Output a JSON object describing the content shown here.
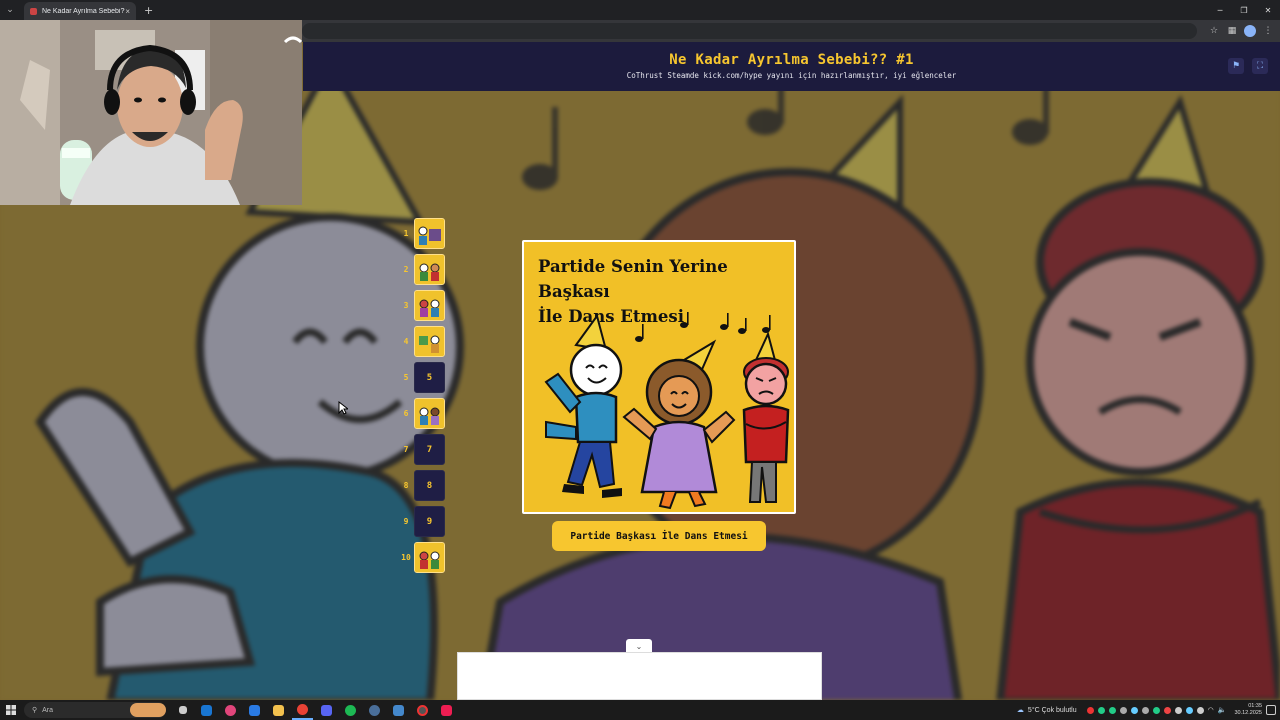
{
  "browser": {
    "tab_title": "Ne Kadar Ayrılma Sebebi?? #1",
    "new_tab": "+",
    "close_tab": "×"
  },
  "page": {
    "title": "Ne Kadar Ayrılma Sebebi?? #1",
    "subtitle": "CoThrust Steamde kick.com/hype yayını için hazırlanmıştır, iyi eğlenceler"
  },
  "levels": [
    {
      "number": "1",
      "state": "image"
    },
    {
      "number": "2",
      "state": "image"
    },
    {
      "number": "3",
      "state": "image"
    },
    {
      "number": "4",
      "state": "image"
    },
    {
      "number": "5",
      "state": "locked",
      "label": "5"
    },
    {
      "number": "6",
      "state": "image"
    },
    {
      "number": "7",
      "state": "locked",
      "label": "7"
    },
    {
      "number": "8",
      "state": "locked",
      "label": "8"
    },
    {
      "number": "9",
      "state": "locked",
      "label": "9"
    },
    {
      "number": "10",
      "state": "image"
    }
  ],
  "card": {
    "title_line1": "Partide Senin Yerine Başkası",
    "title_line2": "İle Dans Etmesi",
    "answer_button": "Partide Başkası İle Dans Etmesi"
  },
  "taskbar": {
    "search_placeholder": "Ara",
    "weather": "5°C  Çok bulutlu",
    "time": "01:35",
    "date": "30.12.2025"
  },
  "colors": {
    "accent_yellow": "#f7c62f",
    "header_navy": "#1c1b3d",
    "background_mustard": "#7b6630"
  }
}
